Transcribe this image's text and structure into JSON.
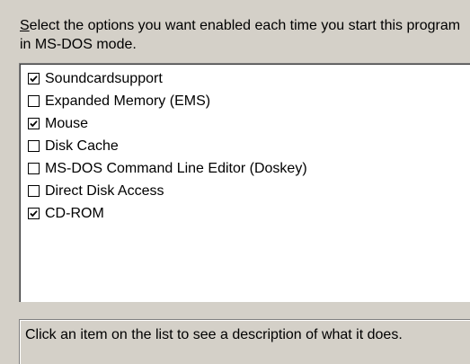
{
  "prompt": {
    "accelerator": "S",
    "rest": "elect the options you want enabled each time you start this program in MS-DOS mode."
  },
  "options": [
    {
      "label": "Soundcardsupport",
      "checked": true
    },
    {
      "label": "Expanded Memory (EMS)",
      "checked": false
    },
    {
      "label": "Mouse",
      "checked": true
    },
    {
      "label": "Disk Cache",
      "checked": false
    },
    {
      "label": "MS-DOS Command Line Editor (Doskey)",
      "checked": false
    },
    {
      "label": "Direct Disk Access",
      "checked": false
    },
    {
      "label": "CD-ROM",
      "checked": true
    }
  ],
  "description": "Click an item on the list to see a description of what it does."
}
